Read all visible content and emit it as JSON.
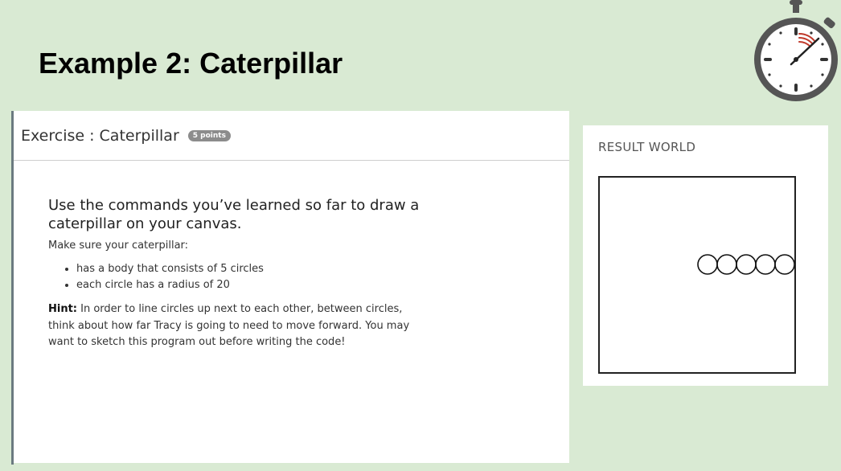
{
  "slide": {
    "title": "Example 2: Caterpillar"
  },
  "exercise": {
    "title": "Exercise : Caterpillar",
    "points_badge": "5 points",
    "prompt": "Use the commands you’ve learned so far to draw a caterpillar on your canvas.",
    "lead": "Make sure your caterpillar:",
    "requirements": [
      "has a body that consists of 5 circles",
      "each circle has a radius of 20"
    ],
    "hint_label": "Hint:",
    "hint_text": " In order to line circles up next to each other, between circles, think about how far Tracy is going to need to move forward. You may want to sketch this program out before writing the code!"
  },
  "result": {
    "title": "RESULT WORLD",
    "circle_count": 5,
    "circle_radius": 20
  },
  "icons": {
    "timer": "stopwatch-icon",
    "turtle": "turtle-icon"
  },
  "colors": {
    "background": "#d9ead3",
    "panel": "#ffffff",
    "badge": "#8c8c8c",
    "timer_accent": "#c0392b"
  }
}
